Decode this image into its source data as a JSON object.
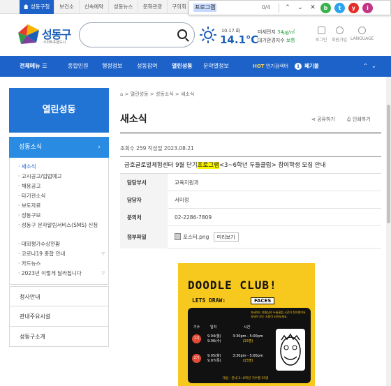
{
  "top_tabs": [
    "성동구청",
    "보건소",
    "신속예약",
    "성동뉴스",
    "문화관광",
    "구의회"
  ],
  "find_bar": {
    "query": "프로그램",
    "count": "0/4",
    "social": [
      "b",
      "t",
      "y",
      "i"
    ]
  },
  "header": {
    "logo_name": "성동구",
    "logo_sub": "스마트포용도시",
    "weather_date": "10.17.화",
    "weather_temp": "14.1℃",
    "air_label1": "미세먼지",
    "air_value1": "34㎍/㎥",
    "air_label2": "대기환경지수",
    "air_value2": "보통",
    "util": [
      "로그인",
      "회원가입",
      "LANGUAGE"
    ]
  },
  "gnb": {
    "all_menu": "전체메뉴 ☰",
    "items": [
      "종합민원",
      "행정정보",
      "성동참여",
      "열린성동",
      "분야별정보"
    ],
    "hot_label": "HOT",
    "hot_text": "인기검색어",
    "hot_num": "1",
    "hot_word": "폐기물"
  },
  "lnb": {
    "title": "열린성동",
    "section": "성동소식",
    "items": [
      "새소식",
      "고시공고/입법예고",
      "채용공고",
      "타기관소식",
      "보도자료",
      "성동구보",
      "성동구 문자알림서비스(SMS) 신청",
      "대외평가수상현황",
      "코로나19 종합 안내",
      "카드뉴스",
      "2023년 이렇게 달라집니다"
    ],
    "subs": [
      "청사안내",
      "관내주요시설",
      "성동구소개"
    ]
  },
  "content": {
    "breadcrumb": [
      "열린성동",
      "성동소식",
      "새소식"
    ],
    "page_title": "새소식",
    "share": "공유하기",
    "print": "인쇄하기",
    "meta": "조회수 259 작성일 2023.08.21",
    "subject_pre": "금호글로벌체험센터 9월 단기",
    "subject_hl": "프로그램",
    "subject_post": "<3~6학년 두들클럽> 참여학생 모집 안내",
    "rows": [
      {
        "k": "담당부서",
        "v": "교육지원과"
      },
      {
        "k": "담당자",
        "v": "서미정"
      },
      {
        "k": "문의처",
        "v": "02-2286-7809"
      },
      {
        "k": "첨부파일",
        "v": "포스터.png"
      }
    ],
    "preview": "미리보기"
  },
  "poster": {
    "title": "DOODLE CLUB!",
    "sub": "LETS DRAW:",
    "tag": "FACES",
    "desc": "자세하는 연필심의 두들클럽 시간이 찾아왔어요. 자세히 보는 사람이 되어보세요.",
    "head": [
      "기수",
      "일자",
      "시간"
    ],
    "g1": "1기",
    "g1_dates": [
      "9.04(월)",
      "9.06(수)"
    ],
    "g1_time": "3:30pm - 5:00pm",
    "g1_note": "(15명)",
    "g2": "2기",
    "g2_dates": [
      "9.05(화)",
      "9.07(목)"
    ],
    "g2_time": "3:30pm - 5:00pm",
    "g2_note": "(15명)",
    "foot": "대상 : 관내 3~6학년 기수별 15명"
  }
}
